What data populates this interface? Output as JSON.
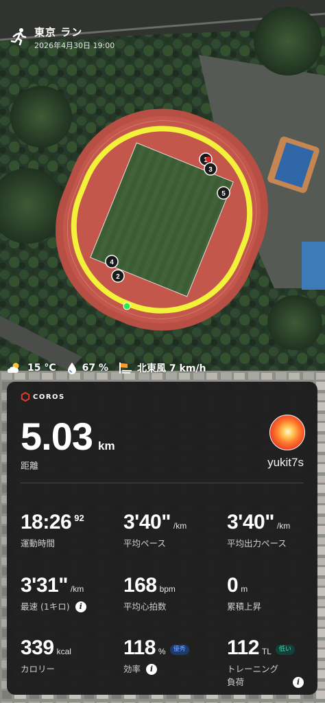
{
  "header": {
    "title": "東京 ラン",
    "datetime": "2026年4月30日 19:00"
  },
  "weather": {
    "temperature": "15 °C",
    "humidity": "67 %",
    "wind": "北東風 7 km/h"
  },
  "route": {
    "markers": [
      "1",
      "3",
      "5",
      "4",
      "2"
    ],
    "track_color": "#f2f23a"
  },
  "card": {
    "brand": "COROS",
    "distance_value": "5.03",
    "distance_unit": "km",
    "distance_label": "距離",
    "username": "yukit7s",
    "stats": [
      {
        "value": "18:26",
        "sup": "92",
        "unit": "",
        "label": "運動時間",
        "badge": "",
        "info": false
      },
      {
        "value": "3'40\"",
        "sup": "",
        "unit": "/km",
        "label": "平均ペース",
        "badge": "",
        "info": false
      },
      {
        "value": "3'40\"",
        "sup": "",
        "unit": "/km",
        "label": "平均出力ペース",
        "badge": "",
        "info": false
      },
      {
        "value": "3'31\"",
        "sup": "",
        "unit": "/km",
        "label": "最速 (1キロ)",
        "badge": "",
        "info": true
      },
      {
        "value": "168",
        "sup": "",
        "unit": "bpm",
        "label": "平均心拍数",
        "badge": "",
        "info": false
      },
      {
        "value": "0",
        "sup": "",
        "unit": "m",
        "label": "累積上昇",
        "badge": "",
        "info": false
      },
      {
        "value": "339",
        "sup": "",
        "unit": "kcal",
        "label": "カロリー",
        "badge": "",
        "info": false
      },
      {
        "value": "118",
        "sup": "",
        "unit": "%",
        "label": "効率",
        "badge": "優秀",
        "info": true
      },
      {
        "value": "112",
        "sup": "",
        "unit": "TL",
        "label": "トレーニング",
        "label2": "負荷",
        "badge": "低い",
        "info": true
      }
    ]
  },
  "icons": {
    "run": "running-person-icon",
    "weather": "partly-cloudy-icon",
    "humidity": "water-drop-icon",
    "wind": "wind-flag-icon",
    "info": "info-icon"
  }
}
